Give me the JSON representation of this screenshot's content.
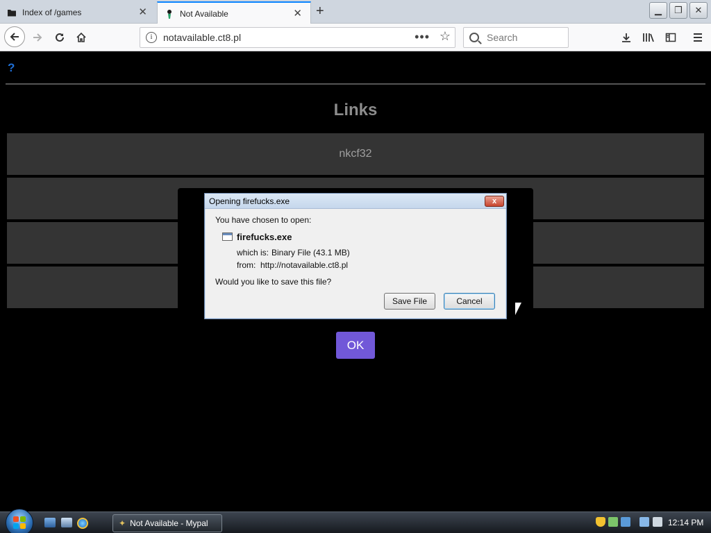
{
  "browser": {
    "tabs": [
      {
        "label": "Index of /games",
        "icon": "folder-icon",
        "active": false
      },
      {
        "label": "Not Available",
        "icon": "site-favicon-icon",
        "active": true
      }
    ],
    "new_tab_icon": "+",
    "url": "notavailable.ct8.pl",
    "search_placeholder": "Search",
    "window_controls": {
      "minimize": "▁",
      "maximize": "❐",
      "close": "✕"
    },
    "toolbar_icons": [
      "download-icon",
      "library-icon",
      "sidebar-icon",
      "menu-icon"
    ]
  },
  "page": {
    "help_icon": "?",
    "title": "Links",
    "links": [
      "nkcf32",
      "",
      "",
      ""
    ],
    "ok_button": "OK"
  },
  "dialog": {
    "title": "Opening firefucks.exe",
    "intro": "You have chosen to open:",
    "file_name": "firefucks.exe",
    "which_label": "which is:",
    "which_value": "Binary File (43.1 MB)",
    "from_label": "from:",
    "from_value": "http://notavailable.ct8.pl",
    "question": "Would you like to save this file?",
    "save_button": "Save File",
    "cancel_button": "Cancel",
    "close_icon": "x"
  },
  "taskbar": {
    "task_label": "Not Available - Mypal",
    "time": "12:14 PM"
  },
  "colors": {
    "page_bg": "#000000",
    "link_row_bg": "#343434",
    "ok_button_bg": "#7158d8",
    "help_icon": "#1f6fd6",
    "active_tab_accent": "#0a84ff"
  }
}
